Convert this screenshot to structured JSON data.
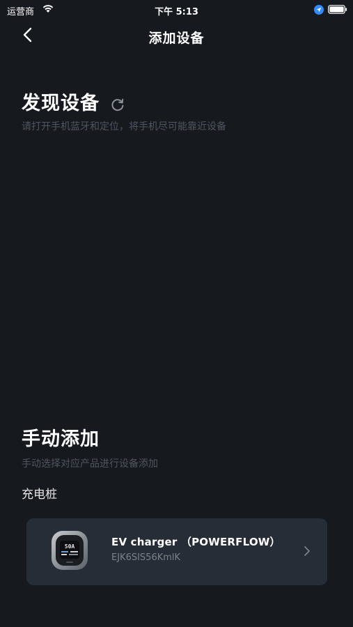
{
  "status_bar": {
    "carrier": "运营商",
    "time": "下午 5:13"
  },
  "nav": {
    "title": "添加设备"
  },
  "discover": {
    "title": "发现设备",
    "hint": "请打开手机蓝牙和定位，将手机尽可能靠近设备"
  },
  "manual": {
    "title": "手动添加",
    "hint": "手动选择对应产品进行设备添加",
    "category": "充电桩",
    "devices": [
      {
        "name": "EV charger （POWERFLOW）",
        "id": "EJK6SIS56KmlK"
      }
    ]
  },
  "colors": {
    "background": "#16191e",
    "card": "#272d37",
    "hint_text": "#4f5560",
    "location_accent": "#2f8cff"
  },
  "icons": [
    "wifi-icon",
    "location-arrow-icon",
    "battery-icon",
    "back-chevron-icon",
    "refresh-icon",
    "chevron-right-icon",
    "ev-charger-image"
  ]
}
